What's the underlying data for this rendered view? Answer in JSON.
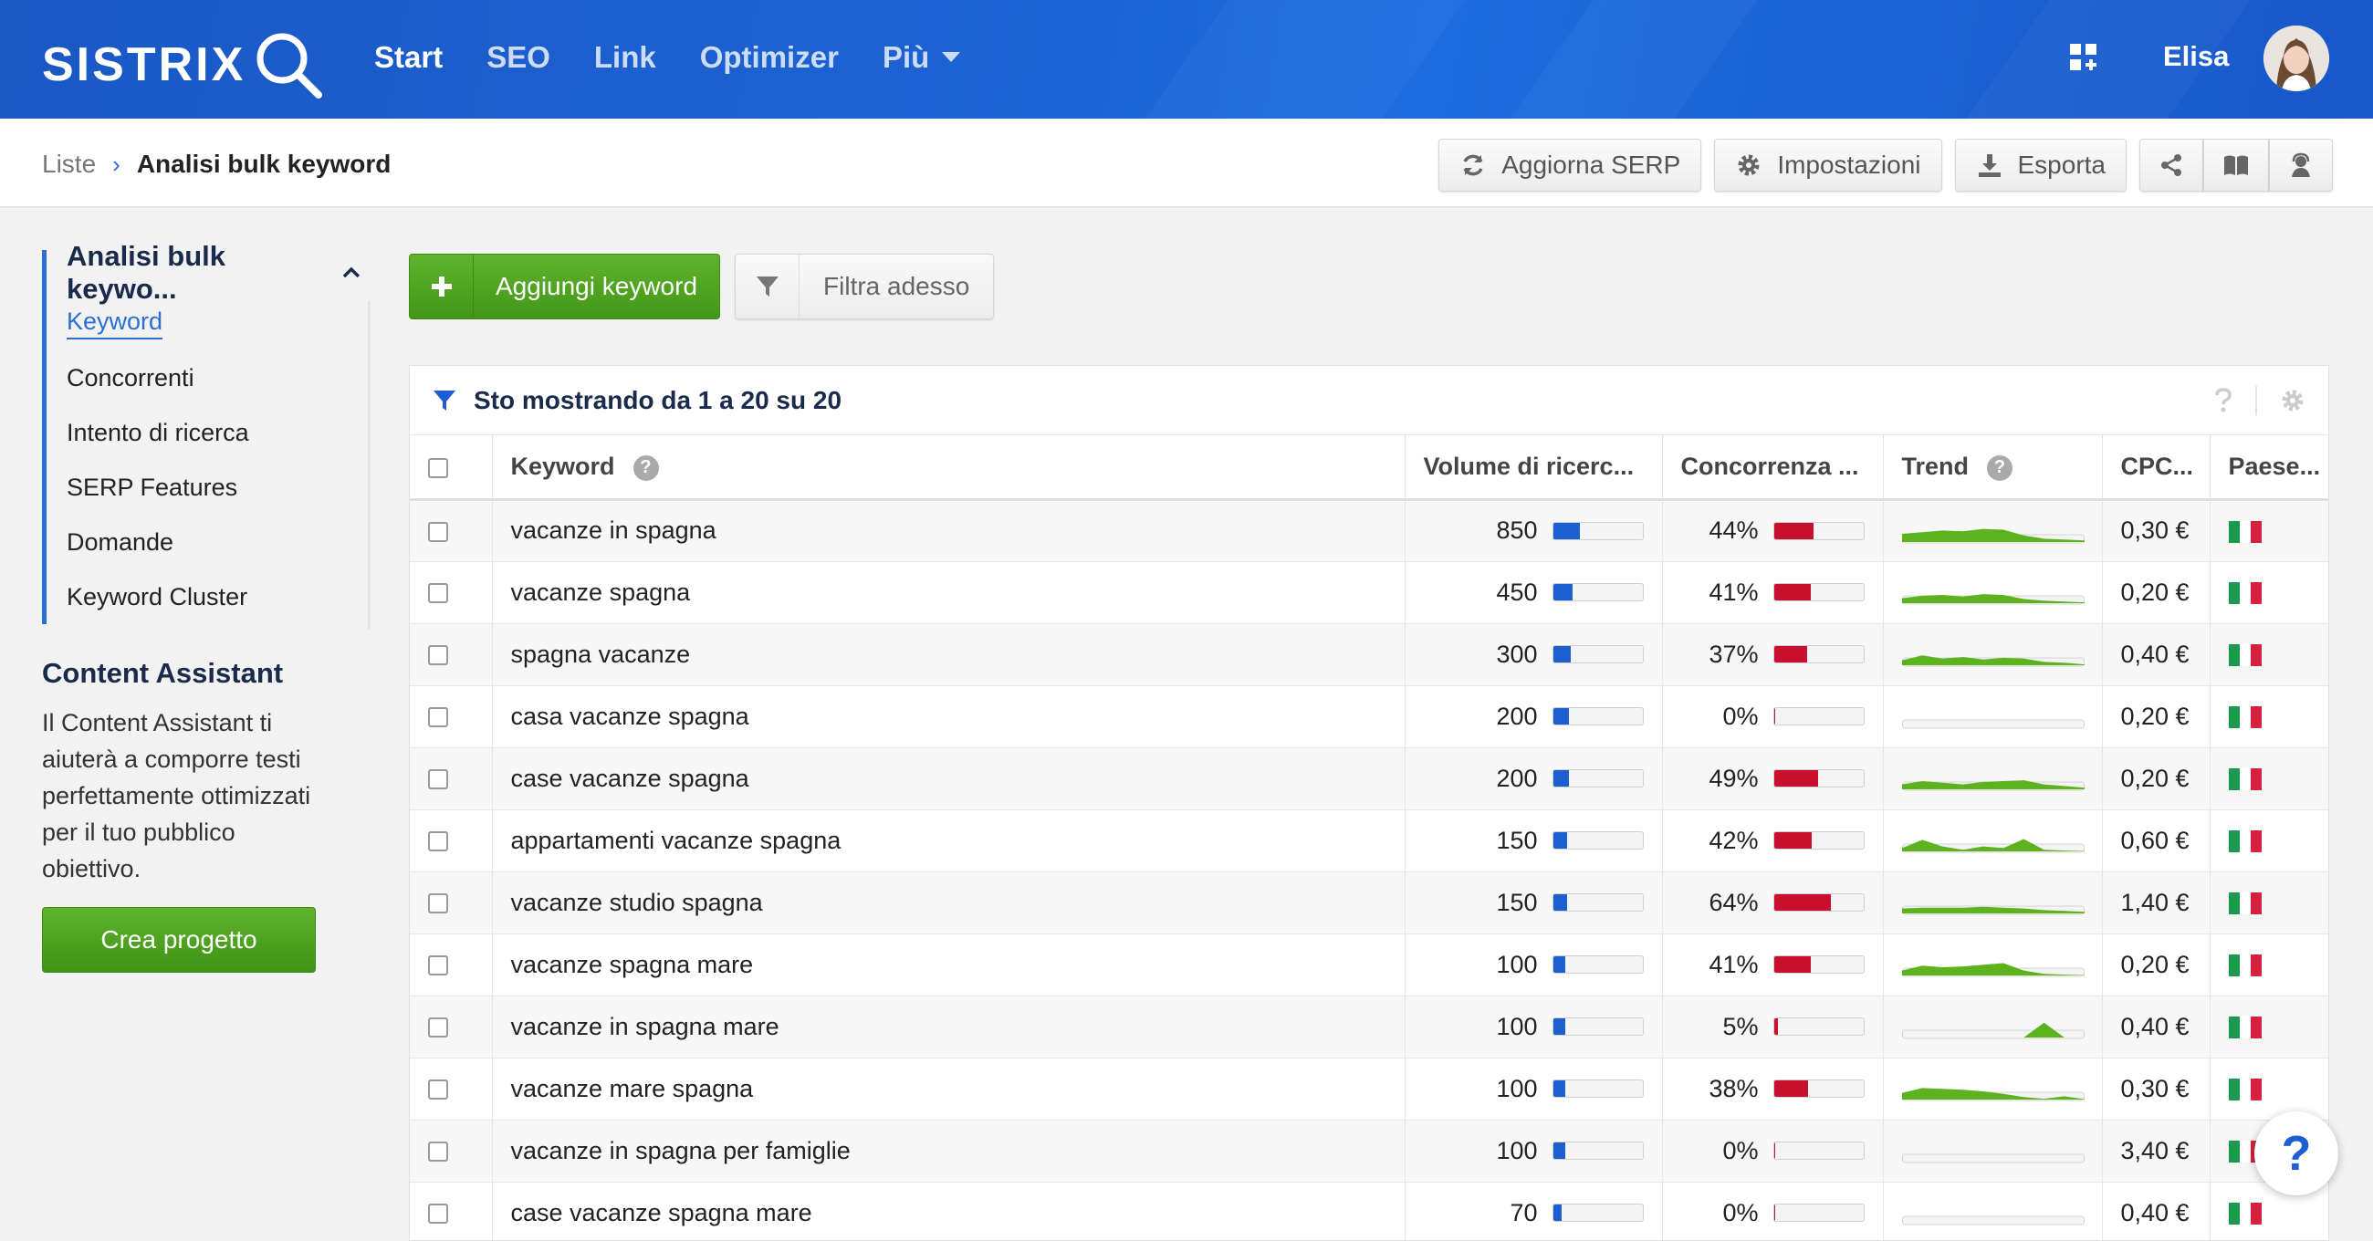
{
  "brand": {
    "logo_text": "SISTRIX",
    "accent": "#1d64d6",
    "green": "#4a9f1c"
  },
  "nav": [
    {
      "label": "Start",
      "active": true
    },
    {
      "label": "SEO",
      "active": false
    },
    {
      "label": "Link",
      "active": false
    },
    {
      "label": "Optimizer",
      "active": false
    },
    {
      "label": "Più",
      "active": false,
      "has_dropdown": true
    }
  ],
  "user": {
    "name": "Elisa"
  },
  "breadcrumb": {
    "parent": "Liste",
    "current": "Analisi bulk keyword"
  },
  "toolbar": {
    "refresh_label": "Aggiorna SERP",
    "settings_label": "Impostazioni",
    "export_label": "Esporta"
  },
  "sidebar": {
    "title": "Analisi bulk keywo...",
    "items": [
      {
        "label": "Keyword",
        "active": true
      },
      {
        "label": "Concorrenti",
        "active": false
      },
      {
        "label": "Intento di ricerca",
        "active": false
      },
      {
        "label": "SERP Features",
        "active": false
      },
      {
        "label": "Domande",
        "active": false
      },
      {
        "label": "Keyword Cluster",
        "active": false
      }
    ],
    "content_assistant": {
      "title": "Content Assistant",
      "text": "Il Content Assistant ti aiuterà a comporre testi perfettamente ottimizzati per il tuo pubblico obiettivo.",
      "button": "Crea progetto"
    }
  },
  "actions": {
    "add_label": "Aggiungi keyword",
    "filter_label": "Filtra adesso"
  },
  "table": {
    "summary": "Sto mostrando da 1 a 20 su 20",
    "columns": {
      "keyword": "Keyword",
      "volume": "Volume di ricerc...",
      "competition": "Concorrenza ...",
      "trend": "Trend",
      "cpc": "CPC...",
      "country": "Paese..."
    },
    "rows": [
      {
        "keyword": "vacanze in spagna",
        "volume": "850",
        "volume_pct": 30,
        "competition": "44%",
        "competition_pct": 44,
        "trend": [
          0.5,
          0.6,
          0.7,
          0.65,
          0.8,
          0.75,
          0.4,
          0.2,
          0.15,
          0.1
        ],
        "cpc": "0,30 €"
      },
      {
        "keyword": "vacanze spagna",
        "volume": "450",
        "volume_pct": 22,
        "competition": "41%",
        "competition_pct": 41,
        "trend": [
          0.3,
          0.45,
          0.5,
          0.4,
          0.55,
          0.5,
          0.25,
          0.15,
          0.1,
          0.05
        ],
        "cpc": "0,20 €"
      },
      {
        "keyword": "spagna vacanze",
        "volume": "300",
        "volume_pct": 20,
        "competition": "37%",
        "competition_pct": 37,
        "trend": [
          0.3,
          0.6,
          0.4,
          0.5,
          0.35,
          0.45,
          0.4,
          0.2,
          0.15,
          0.05
        ],
        "cpc": "0,40 €"
      },
      {
        "keyword": "casa vacanze spagna",
        "volume": "200",
        "volume_pct": 18,
        "competition": "0%",
        "competition_pct": 0,
        "trend": [
          0,
          0,
          0,
          0,
          0,
          0,
          0,
          0,
          0,
          0
        ],
        "cpc": "0,20 €"
      },
      {
        "keyword": "case vacanze spagna",
        "volume": "200",
        "volume_pct": 18,
        "competition": "49%",
        "competition_pct": 49,
        "trend": [
          0.3,
          0.5,
          0.4,
          0.3,
          0.45,
          0.5,
          0.55,
          0.3,
          0.2,
          0.1
        ],
        "cpc": "0,20 €"
      },
      {
        "keyword": "appartamenti vacanze spagna",
        "volume": "150",
        "volume_pct": 16,
        "competition": "42%",
        "competition_pct": 42,
        "trend": [
          0.2,
          0.7,
          0.3,
          0.1,
          0.3,
          0.2,
          0.75,
          0.1,
          0.05,
          0.02
        ],
        "cpc": "0,60 €"
      },
      {
        "keyword": "vacanze studio spagna",
        "volume": "150",
        "volume_pct": 16,
        "competition": "64%",
        "competition_pct": 64,
        "trend": [
          0.3,
          0.35,
          0.35,
          0.35,
          0.4,
          0.35,
          0.3,
          0.2,
          0.15,
          0.1
        ],
        "cpc": "1,40 €"
      },
      {
        "keyword": "vacanze spagna mare",
        "volume": "100",
        "volume_pct": 14,
        "competition": "41%",
        "competition_pct": 41,
        "trend": [
          0.3,
          0.6,
          0.5,
          0.55,
          0.65,
          0.75,
          0.3,
          0.1,
          0.05,
          0.02
        ],
        "cpc": "0,20 €"
      },
      {
        "keyword": "vacanze in spagna mare",
        "volume": "100",
        "volume_pct": 14,
        "competition": "5%",
        "competition_pct": 5,
        "trend": [
          0,
          0,
          0,
          0,
          0,
          0,
          0,
          0.9,
          0,
          0
        ],
        "cpc": "0,40 €"
      },
      {
        "keyword": "vacanze mare spagna",
        "volume": "100",
        "volume_pct": 14,
        "competition": "38%",
        "competition_pct": 38,
        "trend": [
          0.4,
          0.7,
          0.65,
          0.6,
          0.5,
          0.35,
          0.15,
          0.05,
          0.2,
          0.02
        ],
        "cpc": "0,30 €"
      },
      {
        "keyword": "vacanze in spagna per famiglie",
        "volume": "100",
        "volume_pct": 14,
        "competition": "0%",
        "competition_pct": 0,
        "trend": [
          0,
          0,
          0,
          0,
          0,
          0,
          0,
          0,
          0,
          0
        ],
        "cpc": "3,40 €"
      },
      {
        "keyword": "case vacanze spagna mare",
        "volume": "70",
        "volume_pct": 10,
        "competition": "0%",
        "competition_pct": 0,
        "trend": [
          0,
          0,
          0,
          0,
          0,
          0,
          0,
          0,
          0,
          0
        ],
        "cpc": "0,40 €"
      }
    ]
  },
  "floating_help": "?"
}
